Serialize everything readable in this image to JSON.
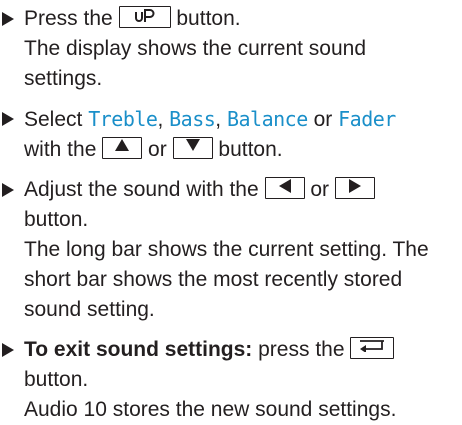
{
  "steps": [
    {
      "l1_pre": "Press the ",
      "l1_post": " button.",
      "key": "sound-settings-key",
      "l2": "The display shows the current sound",
      "l3": "settings."
    },
    {
      "select": "Select ",
      "options": [
        "Treble",
        "Bass",
        "Balance",
        "Fader"
      ],
      "sep1": ", ",
      "sep2": ", ",
      "or1": " or ",
      "l2_pre": "with the ",
      "l2_mid": " or ",
      "l2_post": " button."
    },
    {
      "l1_pre": "Adjust the sound with the ",
      "l1_mid": " or ",
      "l2": "button.",
      "l3": "The long bar shows the current setting. The",
      "l4": "short bar shows the most recently stored",
      "l5": "sound setting."
    },
    {
      "bold": "To exit sound settings:",
      "l1_post": " press the ",
      "l2": "button.",
      "l3": "Audio 10 stores the new sound settings."
    }
  ],
  "icons": {
    "sound": "sound-settings-icon",
    "up": "up-arrow-icon",
    "down": "down-arrow-icon",
    "left": "left-arrow-icon",
    "right": "right-arrow-icon",
    "back": "back-icon"
  }
}
